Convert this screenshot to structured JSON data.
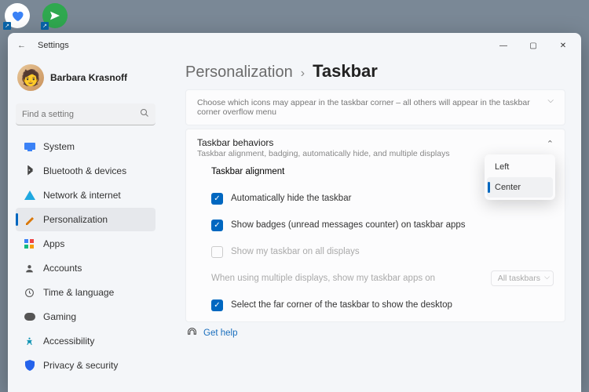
{
  "window": {
    "app": "Settings"
  },
  "user": {
    "name": "Barbara Krasnoff"
  },
  "search": {
    "placeholder": "Find a setting"
  },
  "nav": [
    {
      "label": "System",
      "icon": "system"
    },
    {
      "label": "Bluetooth & devices",
      "icon": "bluetooth"
    },
    {
      "label": "Network & internet",
      "icon": "network"
    },
    {
      "label": "Personalization",
      "icon": "personalization",
      "active": true
    },
    {
      "label": "Apps",
      "icon": "apps"
    },
    {
      "label": "Accounts",
      "icon": "accounts"
    },
    {
      "label": "Time & language",
      "icon": "time"
    },
    {
      "label": "Gaming",
      "icon": "gaming"
    },
    {
      "label": "Accessibility",
      "icon": "accessibility"
    },
    {
      "label": "Privacy & security",
      "icon": "privacy"
    }
  ],
  "breadcrumb": {
    "parent": "Personalization",
    "current": "Taskbar"
  },
  "overflow_hint": "Choose which icons may appear in the taskbar corner – all others will appear in the taskbar corner overflow menu",
  "behaviors": {
    "title": "Taskbar behaviors",
    "sub": "Taskbar alignment, badging, automatically hide, and multiple displays",
    "alignment_label": "Taskbar alignment",
    "alignment_options": {
      "left": "Left",
      "center": "Center"
    },
    "auto_hide": "Automatically hide the taskbar",
    "badges": "Show badges (unread messages counter) on taskbar apps",
    "all_displays": "Show my taskbar on all displays",
    "multi_label": "When using multiple displays, show my taskbar apps on",
    "multi_value": "All taskbars",
    "far_corner": "Select the far corner of the taskbar to show the desktop"
  },
  "help": {
    "label": "Get help"
  }
}
